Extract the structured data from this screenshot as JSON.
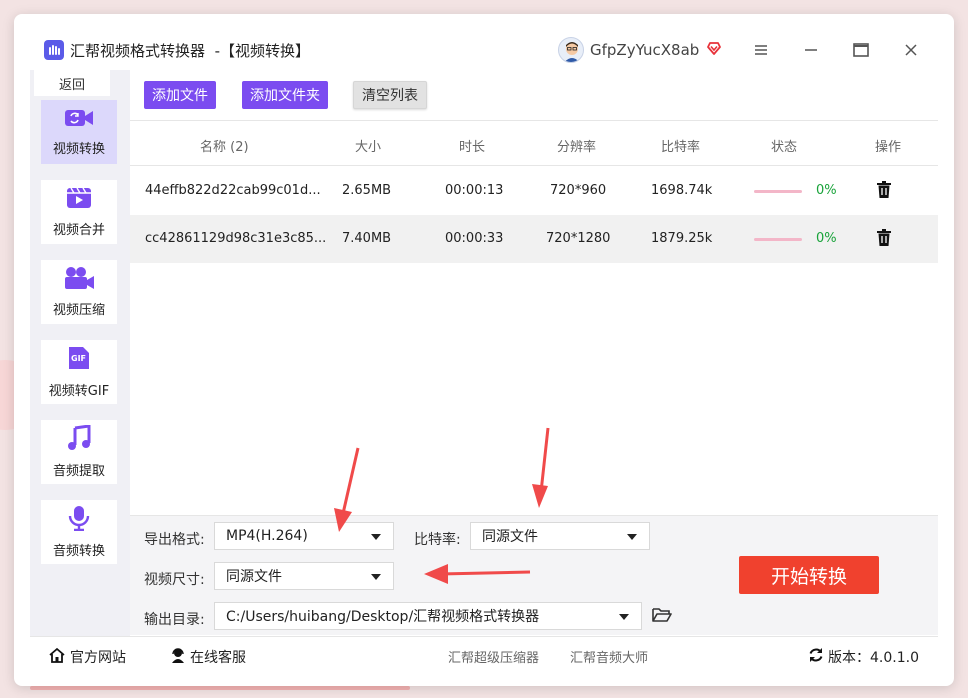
{
  "window": {
    "title": "汇帮视频格式转换器",
    "subtitle": "-【视频转换】",
    "username": "GfpZyYucX8ab"
  },
  "sidebar": {
    "back_label": "返回",
    "items": [
      {
        "label": "视频转换",
        "icon": "video-convert-icon",
        "active": true
      },
      {
        "label": "视频合并",
        "icon": "video-merge-icon"
      },
      {
        "label": "视频压缩",
        "icon": "video-compress-icon"
      },
      {
        "label": "视频转GIF",
        "icon": "gif-icon"
      },
      {
        "label": "音频提取",
        "icon": "music-note-icon"
      },
      {
        "label": "音频转换",
        "icon": "microphone-icon"
      }
    ]
  },
  "toolbar": {
    "add_file": "添加文件",
    "add_folder": "添加文件夹",
    "clear_list": "清空列表"
  },
  "table": {
    "headers": {
      "name": "名称 (2)",
      "size": "大小",
      "duration": "时长",
      "resolution": "分辨率",
      "bitrate": "比特率",
      "status": "状态",
      "action": "操作"
    },
    "rows": [
      {
        "name": "44effb822d22cab99c01d...",
        "size": "2.65MB",
        "duration": "00:00:13",
        "resolution": "720*960",
        "bitrate": "1698.74k",
        "progress": "0%"
      },
      {
        "name": "cc42861129d98c31e3c85...",
        "size": "7.40MB",
        "duration": "00:00:33",
        "resolution": "720*1280",
        "bitrate": "1879.25k",
        "progress": "0%"
      }
    ]
  },
  "settings": {
    "format_label": "导出格式:",
    "format_value": "MP4(H.264)",
    "bitrate_label": "比特率:",
    "bitrate_value": "同源文件",
    "size_label": "视频尺寸:",
    "size_value": "同源文件",
    "output_label": "输出目录:",
    "output_value": "C:/Users/huibang/Desktop/汇帮视频格式转换器",
    "start_label": "开始转换"
  },
  "footer": {
    "website": "官方网站",
    "support": "在线客服",
    "product1": "汇帮超级压缩器",
    "product2": "汇帮音频大师",
    "version": "版本：4.0.1.0"
  },
  "colors": {
    "accent_purple": "#7b4cf0",
    "start_red": "#f0412e",
    "progress_green": "#19a33a",
    "annotation_red": "#f04a4a"
  }
}
